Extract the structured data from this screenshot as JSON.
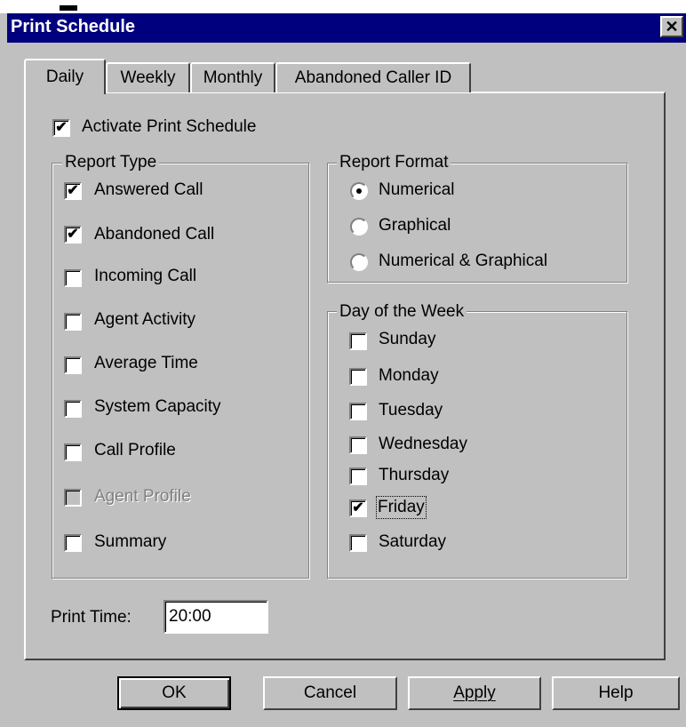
{
  "window": {
    "title": "Print Schedule",
    "close_glyph": "✕"
  },
  "tabs": [
    {
      "label": "Daily",
      "selected": true
    },
    {
      "label": "Weekly",
      "selected": false
    },
    {
      "label": "Monthly",
      "selected": false
    },
    {
      "label": "Abandoned Caller ID",
      "selected": false
    }
  ],
  "activate": {
    "label": "Activate Print Schedule",
    "checked": true
  },
  "report_type": {
    "legend": "Report Type",
    "items": [
      {
        "label": "Answered Call",
        "checked": true,
        "enabled": true
      },
      {
        "label": "Abandoned Call",
        "checked": true,
        "enabled": true
      },
      {
        "label": "Incoming Call",
        "checked": false,
        "enabled": true
      },
      {
        "label": "Agent Activity",
        "checked": false,
        "enabled": true
      },
      {
        "label": "Average Time",
        "checked": false,
        "enabled": true
      },
      {
        "label": "System Capacity",
        "checked": false,
        "enabled": true
      },
      {
        "label": "Call Profile",
        "checked": false,
        "enabled": true
      },
      {
        "label": "Agent Profile",
        "checked": false,
        "enabled": false
      },
      {
        "label": "Summary",
        "checked": false,
        "enabled": true
      }
    ]
  },
  "report_format": {
    "legend": "Report Format",
    "options": [
      {
        "label": "Numerical",
        "selected": true
      },
      {
        "label": "Graphical",
        "selected": false
      },
      {
        "label": "Numerical & Graphical",
        "selected": false
      }
    ]
  },
  "day_of_week": {
    "legend": "Day of the Week",
    "days": [
      {
        "label": "Sunday",
        "checked": false
      },
      {
        "label": "Monday",
        "checked": false
      },
      {
        "label": "Tuesday",
        "checked": false
      },
      {
        "label": "Wednesday",
        "checked": false
      },
      {
        "label": "Thursday",
        "checked": false
      },
      {
        "label": "Friday",
        "checked": true,
        "focused": true
      },
      {
        "label": "Saturday",
        "checked": false
      }
    ]
  },
  "print_time": {
    "label": "Print Time:",
    "value": "20:00"
  },
  "buttons": {
    "ok": "OK",
    "cancel": "Cancel",
    "apply": "Apply",
    "help": "Help"
  },
  "check_glyph": "✔",
  "colors": {
    "titlebar": "#00007e",
    "face": "#c0c0c0"
  }
}
